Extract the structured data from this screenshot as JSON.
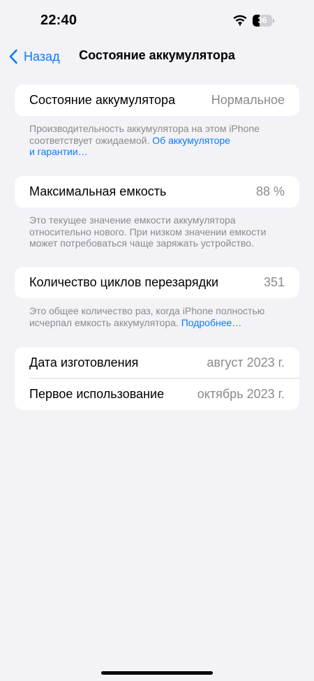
{
  "status_bar": {
    "time": "22:40",
    "battery_level": "36",
    "battery_fraction": 0.36,
    "wifi_icon": "wifi-icon",
    "battery_icon": "battery-icon"
  },
  "nav": {
    "back_label": "Назад",
    "back_icon": "chevron-left-icon",
    "title": "Состояние аккумулятора"
  },
  "sections": {
    "health": {
      "label": "Состояние аккумулятора",
      "value": "Нормальное",
      "footnote_text": "Производительность аккумулятора на этом iPhone соответствует ожидаемой. ",
      "footnote_link_line1": "Об аккумуляторе",
      "footnote_link_line2": "и гарантии…"
    },
    "capacity": {
      "label": "Максимальная емкость",
      "value": "88 %",
      "footnote_text": "Это текущее значение емкости аккумулятора относительно нового. При низком значении емкости может потребоваться чаще заряжать устройство."
    },
    "cycles": {
      "label": "Количество циклов перезарядки",
      "value": "351",
      "footnote_text": "Это общее количество раз, когда iPhone полностью исчерпал емкость аккумулятора. ",
      "footnote_link": "Подробнее…"
    },
    "dates": {
      "manufacture_label": "Дата изготовления",
      "manufacture_value": "август 2023 г.",
      "first_use_label": "Первое использование",
      "first_use_value": "октябрь 2023 г."
    }
  },
  "colors": {
    "background": "#F2F2F7",
    "card": "#FFFFFF",
    "accent": "#0A7AFF",
    "secondary_text": "#8A8A8E"
  }
}
